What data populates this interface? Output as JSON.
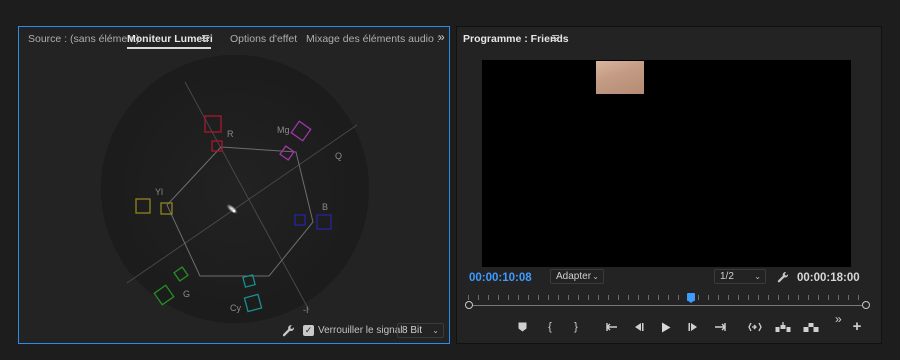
{
  "source_panel": {
    "tabs": [
      {
        "label": "Source : (sans élément)"
      },
      {
        "label": "Moniteur Lumetri",
        "active": true
      },
      {
        "label": "Options d'effet"
      },
      {
        "label": "Mixage des éléments audio :"
      }
    ],
    "overflow_label": "»",
    "vectorscope": {
      "targets": [
        {
          "label": "R",
          "color": "#c0152a"
        },
        {
          "label": "Mg",
          "color": "#c03bc0"
        },
        {
          "label": "B",
          "color": "#2a2ab8"
        },
        {
          "label": "Cy",
          "color": "#1ea8a8"
        },
        {
          "label": "G",
          "color": "#2ea82e"
        },
        {
          "label": "Yl",
          "color": "#b0a028"
        }
      ],
      "axis_labels": {
        "q": "Q",
        "i": "-I"
      }
    },
    "footer": {
      "lock_signal_label": "Verrouiller le signal",
      "lock_signal_checked": true,
      "bit_depth": "8 Bit"
    }
  },
  "program_panel": {
    "title": "Programme : Friends",
    "current_timecode": "00:00:10:08",
    "duration_timecode": "00:00:18:00",
    "zoom": "Adapter",
    "resolution": "1/2",
    "playhead_position": 0.56,
    "accent_color": "#3f9bff",
    "controls": [
      {
        "name": "add-marker-button",
        "icon": "marker-icon"
      },
      {
        "name": "mark-in-button",
        "icon": "mark-in-icon",
        "glyph": "{"
      },
      {
        "name": "mark-out-button",
        "icon": "mark-out-icon",
        "glyph": "}"
      },
      {
        "name": "go-to-in-button",
        "icon": "go-to-in-icon"
      },
      {
        "name": "step-back-button",
        "icon": "step-back-icon"
      },
      {
        "name": "play-button",
        "icon": "play-icon"
      },
      {
        "name": "step-forward-button",
        "icon": "step-forward-icon"
      },
      {
        "name": "go-to-out-button",
        "icon": "go-to-out-icon"
      },
      {
        "name": "insert-button",
        "icon": "insert-icon"
      },
      {
        "name": "lift-button",
        "icon": "lift-icon"
      },
      {
        "name": "extract-button",
        "icon": "extract-icon"
      },
      {
        "name": "add-button",
        "icon": "plus-icon",
        "glyph": "+"
      }
    ],
    "overflow_label": "»"
  }
}
